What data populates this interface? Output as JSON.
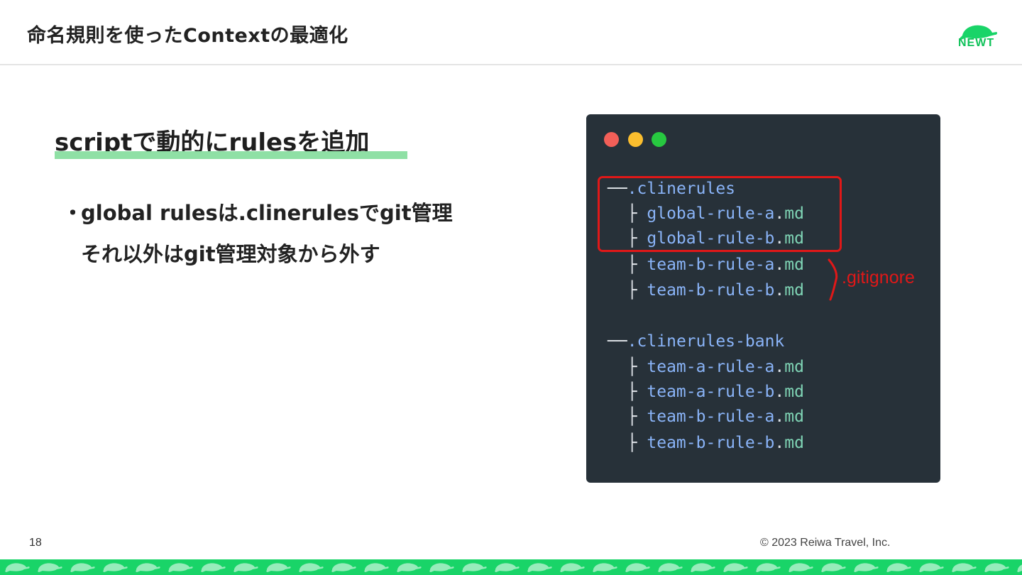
{
  "header": {
    "title": "命名規則を使ったContextの最適化",
    "logo_text": "NEWT",
    "brand_color": "#19d468"
  },
  "section": {
    "title": "scriptで動的にrulesを追加"
  },
  "bullets": [
    {
      "marker": "・",
      "line1": "global rulesは.clinerulesでgit管理",
      "line2": "それ以外はgit管理対象から外す"
    }
  ],
  "code_window": {
    "lines": [
      {
        "prefix": "──",
        "name": ".clinerules",
        "ext": ""
      },
      {
        "prefix": "  ├ ",
        "name": "global-rule-a",
        "ext": "md"
      },
      {
        "prefix": "  ├ ",
        "name": "global-rule-b",
        "ext": "md"
      },
      {
        "prefix": "  ├ ",
        "name": "team-b-rule-a",
        "ext": "md"
      },
      {
        "prefix": "  ├ ",
        "name": "team-b-rule-b",
        "ext": "md"
      },
      {
        "prefix": "──",
        "name": ".clinerules-bank",
        "ext": ""
      },
      {
        "prefix": "  ├ ",
        "name": "team-a-rule-a",
        "ext": "md"
      },
      {
        "prefix": "  ├ ",
        "name": "team-a-rule-b",
        "ext": "md"
      },
      {
        "prefix": "  ├ ",
        "name": "team-b-rule-a",
        "ext": "md"
      },
      {
        "prefix": "  ├ ",
        "name": "team-b-rule-b",
        "ext": "md"
      }
    ],
    "annotation": ".gitignore",
    "annotation_color": "#e01818"
  },
  "footer": {
    "page_number": "18",
    "copyright": "© 2023 Reiwa Travel, Inc."
  }
}
